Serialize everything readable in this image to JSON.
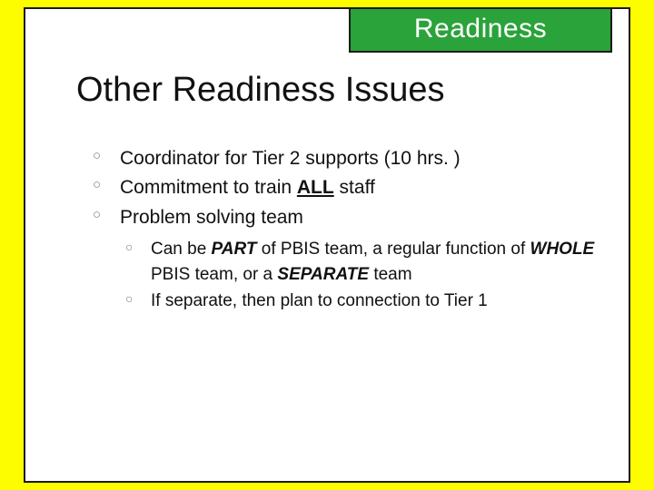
{
  "tag": "Readiness",
  "title": "Other Readiness Issues",
  "bullets": {
    "b1": "Coordinator for Tier 2 supports (10 hrs. )",
    "b2_pre": "Commitment to train ",
    "b2_em": "ALL",
    "b2_post": " staff",
    "b3": "Problem solving team",
    "s1_pre": "Can be ",
    "s1_em1": "PART",
    "s1_mid1": " of PBIS team, a regular function of ",
    "s1_em2": "WHOLE",
    "s1_mid2": " PBIS team, or a ",
    "s1_em3": "SEPARATE",
    "s1_post": " team",
    "s2": "If separate, then plan to connection to Tier 1"
  }
}
